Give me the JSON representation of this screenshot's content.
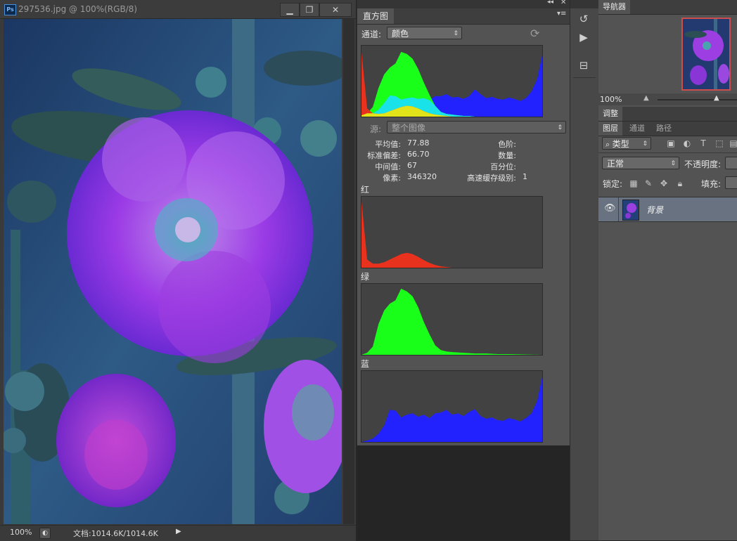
{
  "document": {
    "title": "297536.jpg @ 100%(RGB/8)",
    "zoom": "100%",
    "info": "文档:1014.6K/1014.6K",
    "buttons": {
      "minimize": "▁",
      "restore": "❐",
      "close": "✕"
    },
    "icons": [
      "ps-logo-icon",
      "image-photo",
      "status-arrow-icon"
    ]
  },
  "histogram": {
    "tab_label": "直方图",
    "channel_label": "通道:",
    "channel_value": "颜色",
    "source_label": "源:",
    "source_value": "整个图像",
    "stats": {
      "mean_label": "平均值:",
      "mean": "77.88",
      "stddev_label": "标准偏差:",
      "stddev": "66.70",
      "median_label": "中间值:",
      "median": "67",
      "pixels_label": "像素:",
      "pixels": "346320",
      "level_label": "色阶:",
      "count_label": "数量:",
      "percentile_label": "百分位:",
      "cache_label": "高速缓存级别:",
      "cache": "1"
    },
    "red_label": "红",
    "green_label": "绿",
    "blue_label": "蓝",
    "colors": {
      "red": "#e8321e",
      "green": "#1aff1a",
      "blue": "#2222ff",
      "cyan": "#19e3e8",
      "yellow": "#e3e31a"
    }
  },
  "chart_data": [
    {
      "type": "area",
      "name": "composite",
      "x": [
        0,
        8,
        16,
        24,
        32,
        40,
        48,
        56,
        64,
        72,
        80,
        88,
        96,
        104,
        112,
        120,
        128,
        136,
        144,
        152,
        160,
        168,
        176,
        184,
        192,
        200,
        208,
        216,
        224,
        232,
        240,
        248,
        255
      ],
      "series": [
        {
          "name": "red",
          "values": [
            0.95,
            0.12,
            0.05,
            0.04,
            0.05,
            0.08,
            0.11,
            0.14,
            0.16,
            0.15,
            0.12,
            0.08,
            0.05,
            0.03,
            0.02,
            0.01,
            0.0,
            0,
            0,
            0,
            0,
            0,
            0,
            0,
            0,
            0,
            0,
            0,
            0,
            0,
            0,
            0,
            0
          ]
        },
        {
          "name": "green",
          "values": [
            0.02,
            0.05,
            0.14,
            0.42,
            0.62,
            0.72,
            0.78,
            0.95,
            0.92,
            0.85,
            0.7,
            0.5,
            0.32,
            0.16,
            0.07,
            0.04,
            0.03,
            0.02,
            0.01,
            0.01,
            0,
            0,
            0,
            0,
            0,
            0,
            0,
            0,
            0,
            0,
            0,
            0,
            0
          ]
        },
        {
          "name": "blue",
          "values": [
            0.02,
            0.03,
            0.05,
            0.1,
            0.2,
            0.31,
            0.3,
            0.25,
            0.27,
            0.28,
            0.26,
            0.27,
            0.24,
            0.3,
            0.3,
            0.33,
            0.28,
            0.29,
            0.26,
            0.3,
            0.4,
            0.33,
            0.27,
            0.29,
            0.26,
            0.25,
            0.28,
            0.26,
            0.23,
            0.27,
            0.37,
            0.55,
            0.9
          ]
        }
      ]
    },
    {
      "type": "area",
      "name": "red",
      "x": [
        0,
        8,
        16,
        24,
        32,
        40,
        48,
        56,
        64,
        72,
        80,
        88,
        96,
        104,
        112,
        120,
        128,
        136,
        255
      ],
      "values": [
        0.98,
        0.12,
        0.06,
        0.06,
        0.08,
        0.12,
        0.16,
        0.2,
        0.22,
        0.2,
        0.16,
        0.11,
        0.07,
        0.04,
        0.02,
        0.01,
        0,
        0,
        0
      ]
    },
    {
      "type": "area",
      "name": "green",
      "x": [
        0,
        8,
        16,
        24,
        32,
        40,
        48,
        56,
        64,
        72,
        80,
        88,
        96,
        104,
        112,
        120,
        128,
        144,
        160,
        176,
        192,
        208,
        255
      ],
      "values": [
        0,
        0.03,
        0.12,
        0.45,
        0.65,
        0.75,
        0.8,
        0.97,
        0.93,
        0.86,
        0.7,
        0.48,
        0.3,
        0.14,
        0.07,
        0.05,
        0.04,
        0.03,
        0.02,
        0.02,
        0.01,
        0.01,
        0
      ]
    },
    {
      "type": "area",
      "name": "blue",
      "x": [
        0,
        8,
        16,
        24,
        32,
        40,
        48,
        56,
        64,
        72,
        80,
        88,
        96,
        104,
        112,
        120,
        128,
        136,
        144,
        152,
        160,
        168,
        176,
        184,
        192,
        200,
        208,
        216,
        224,
        232,
        240,
        248,
        255
      ],
      "values": [
        0,
        0.02,
        0.05,
        0.12,
        0.24,
        0.47,
        0.46,
        0.36,
        0.4,
        0.42,
        0.37,
        0.4,
        0.35,
        0.42,
        0.43,
        0.47,
        0.4,
        0.42,
        0.38,
        0.44,
        0.48,
        0.38,
        0.34,
        0.36,
        0.32,
        0.31,
        0.35,
        0.33,
        0.3,
        0.35,
        0.42,
        0.6,
        0.95
      ]
    }
  ],
  "tool_strip": {
    "icons": [
      "history-icon",
      "play-action-icon",
      "tool-preset-icon",
      "layer-comps-icon"
    ]
  },
  "navigator": {
    "tab_label": "导航器",
    "zoom": "100%"
  },
  "adjustments": {
    "tab_label": "调整"
  },
  "layers": {
    "tabs": [
      "图层",
      "通道",
      "路径"
    ],
    "filter_label": "类型",
    "blend_mode": "正常",
    "opacity_label": "不透明度:",
    "lock_label": "锁定:",
    "fill_label": "填充:",
    "layer_name": "背景",
    "icons": [
      "search-icon",
      "image-filter-icon",
      "adjustment-filter-icon",
      "type-filter-icon",
      "shape-filter-icon",
      "lock-transparent-icon",
      "lock-paint-icon",
      "lock-move-icon",
      "lock-all-icon",
      "eye-icon"
    ]
  }
}
